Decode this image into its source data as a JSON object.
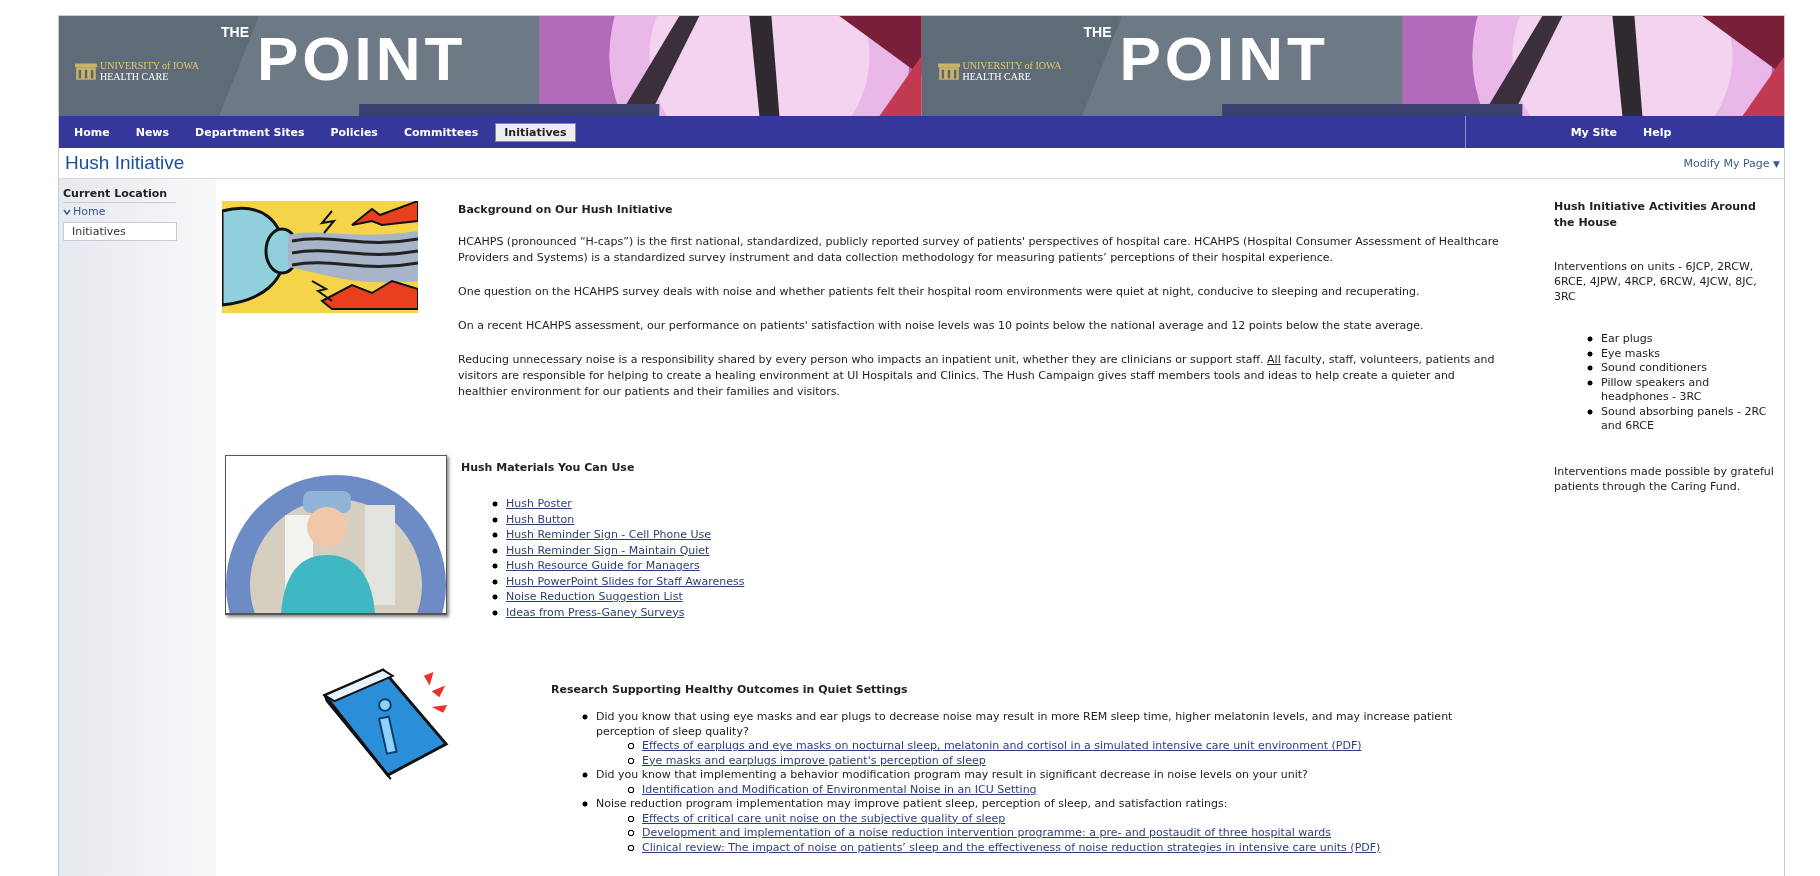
{
  "banner": [
    {
      "kind": "picture",
      "logo_top": "UNIVERSITY of IOWA",
      "logo_bottom": "HEALTH CARE",
      "the": "THE",
      "title": "POINT"
    },
    {
      "kind": "picture",
      "logo_top": "UNIVERSITY of IOWA",
      "logo_bottom": "HEALTH CARE",
      "the": "THE",
      "title": "POINT"
    }
  ],
  "nav": {
    "items": [
      {
        "label": "Home",
        "selected": false
      },
      {
        "label": "News",
        "selected": false
      },
      {
        "label": "Department Sites",
        "selected": false
      },
      {
        "label": "Policies",
        "selected": false
      },
      {
        "label": "Committees",
        "selected": false
      },
      {
        "label": "Initiatives",
        "selected": true
      }
    ],
    "right_items": [
      "My Site",
      "Help"
    ]
  },
  "page_title": "Hush Initiative",
  "modify_menu": {
    "label": "Modify My Page",
    "caret": "▼"
  },
  "sidebar": {
    "heading": "Current Location",
    "items": [
      {
        "label": "Home",
        "expanded": true,
        "children": [
          {
            "label": "Initiatives",
            "selected": true
          }
        ]
      }
    ]
  },
  "sections": [
    {
      "heading": "Background on Our Hush Initiative",
      "paragraphs": [
        [
          {
            "text": "HCAHPS (pronounced “H-caps”) is the first national, standardized, publicly reported survey of patients' perspectives of hospital care. HCAHPS (Hospital Consumer Assessment of Healthcare Providers and Systems) is a standardized survey instrument and data collection methodology for measuring patients’ perceptions of their hospital experience."
          }
        ],
        [
          {
            "text": "One question on the HCAHPS survey deals with noise and whether patients felt their hospital room environments were quiet at night, conducive to sleeping and recuperating."
          }
        ],
        [
          {
            "text": "On a recent HCAHPS assessment, our performance on patients' satisfaction with noise levels was 10 points below the national average and 12 points below the state average."
          }
        ],
        [
          {
            "text": "Reducing unnecessary noise is a responsibility shared by every person who impacts an inpatient unit, whether they are clinicians or support staff. "
          },
          {
            "text": "All",
            "kind": "underline"
          },
          {
            "text": " faculty, staff, volunteers, patients and visitors are responsible for helping to create a healing environment at UI Hospitals and Clinics. The Hush Campaign gives staff members tools and ideas to help create a quieter and healthier environment for our patients and their families and visitors."
          }
        ]
      ]
    },
    {
      "heading": "Hush Materials You Can Use",
      "links": [
        "Hush Poster",
        "Hush Button",
        "Hush Reminder Sign - Cell Phone Use",
        "Hush Reminder Sign - Maintain Quiet",
        "Hush Resource Guide for Managers",
        "Hush PowerPoint Slides for Staff Awareness",
        "Noise Reduction Suggestion List",
        "Ideas from Press-Ganey Surveys"
      ]
    },
    {
      "heading": "Research Supporting Healthy Outcomes in Quiet Settings",
      "items": [
        {
          "text": "Did you know that using eye masks and ear plugs to decrease noise may result in more REM sleep time, higher melatonin levels, and may increase patient perception of sleep quality?",
          "links": [
            "Effects of earplugs and eye masks on nocturnal sleep, melatonin and cortisol in a simulated intensive care unit environment (PDF)",
            "Eye masks and earplugs improve patient's perception of sleep"
          ]
        },
        {
          "text": "Did you know that implementing a behavior modification program may result in significant decrease in noise levels on your unit?",
          "links": [
            "Identification and Modification of Environmental Noise in an ICU Setting"
          ]
        },
        {
          "text": "Noise reduction program implementation may improve patient sleep, perception of sleep, and satisfaction ratings:",
          "links": [
            "Effects of critical care unit noise on the subjective quality of sleep",
            "Development and implementation of a noise reduction intervention programme: a pre- and postaudit of three hospital wards",
            "Clinical review: The impact of noise on patients’ sleep and the effectiveness of noise reduction strategies in intensive care units (PDF)"
          ]
        }
      ]
    }
  ],
  "aside": {
    "heading": "Hush Initiative Activities Around the House",
    "intro": "Interventions on units - 6JCP, 2RCW, 6RCE, 4JPW, 4RCP, 6RCW, 4JCW, 8JC, 3RC",
    "items": [
      "Ear plugs",
      "Eye masks",
      "Sound conditioners",
      "Pillow speakers and headphones - 3RC",
      "Sound absorbing panels - 2RC and 6RCE"
    ],
    "note": "Interventions made possible by grateful patients through the Caring Fund."
  }
}
